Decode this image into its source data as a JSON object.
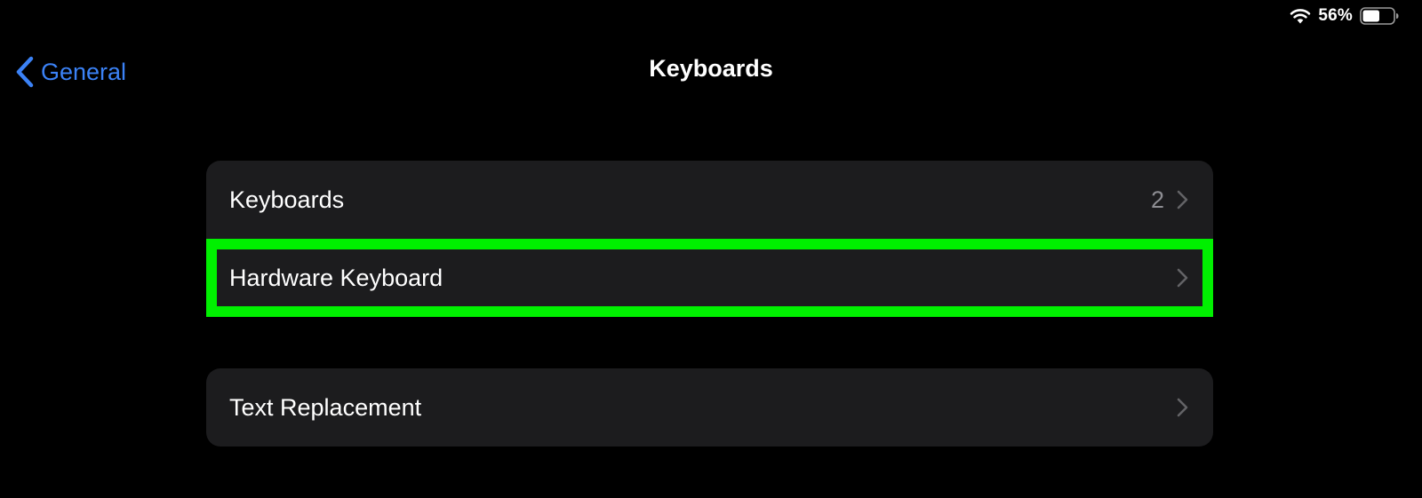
{
  "status_bar": {
    "wifi_icon": "wifi-icon",
    "battery_percent": "56%",
    "battery_icon": "battery-icon",
    "battery_level": 0.56
  },
  "nav": {
    "back_label": "General",
    "back_icon": "chevron-left-icon",
    "title": "Keyboards"
  },
  "groups": [
    {
      "rows": [
        {
          "label": "Keyboards",
          "value": "2",
          "icon": "chevron-right-icon"
        },
        {
          "label": "Hardware Keyboard",
          "value": "",
          "icon": "chevron-right-icon",
          "highlighted": true
        }
      ]
    },
    {
      "rows": [
        {
          "label": "Text Replacement",
          "value": "",
          "icon": "chevron-right-icon"
        }
      ]
    }
  ],
  "colors": {
    "background": "#000000",
    "cell": "#1c1c1e",
    "accent_blue": "#3b82f6",
    "highlight": "#00f000",
    "secondary_text": "#8e8e93"
  }
}
